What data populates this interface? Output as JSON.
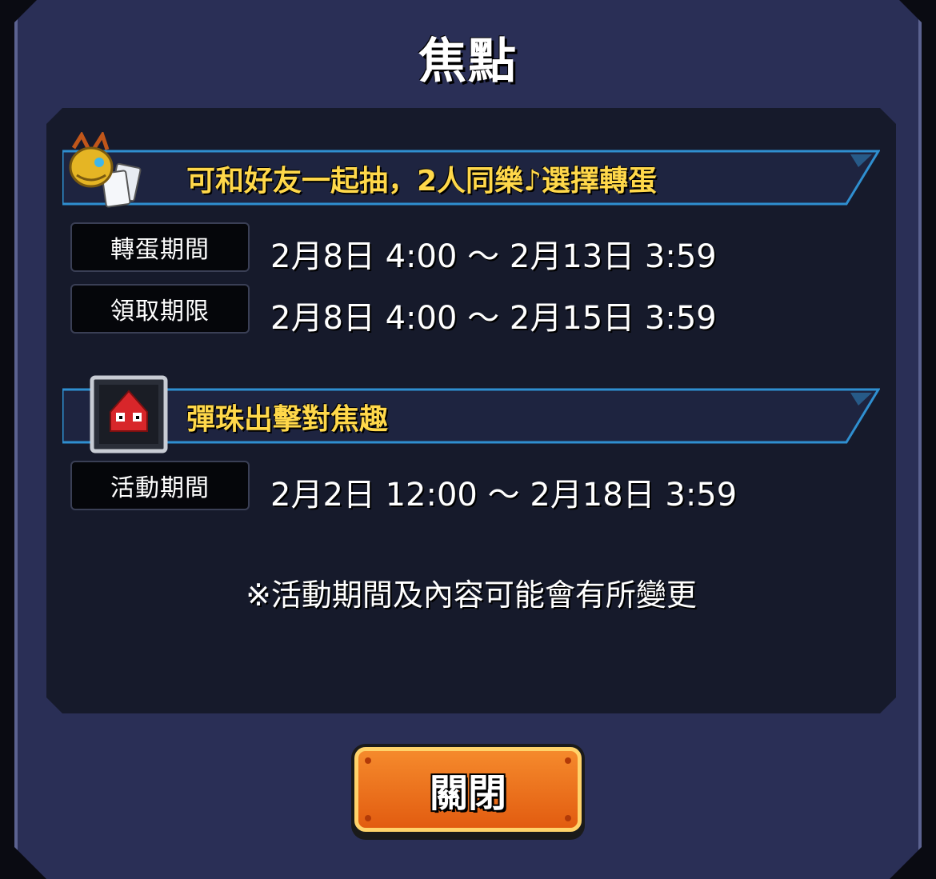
{
  "dialog": {
    "title": "焦點",
    "note": "※活動期間及內容可能會有所變更",
    "close_label": "關閉"
  },
  "events": [
    {
      "icon": "dragon-gacha-icon",
      "title": "可和好友一起抽，2人同樂♪選擇轉蛋",
      "rows": [
        {
          "label": "轉蛋期間",
          "value": "2月8日 4:00 ～ 2月13日 3:59"
        },
        {
          "label": "領取期限",
          "value": "2月8日 4:00 ～ 2月15日 3:59"
        }
      ]
    },
    {
      "icon": "red-monster-stage-icon",
      "title": "彈珠出擊對焦趣",
      "rows": [
        {
          "label": "活動期間",
          "value": "2月2日 12:00 ～ 2月18日 3:59"
        }
      ]
    }
  ],
  "colors": {
    "frame": "#2a2f56",
    "panel": "#161a2b",
    "banner_text": "#ffd84a",
    "banner_border": "#2f8fd0",
    "button": "#e8701a"
  }
}
